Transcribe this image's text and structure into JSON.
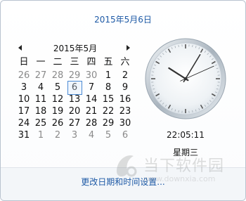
{
  "header": {
    "date_link": "2015年5月6日"
  },
  "calendar": {
    "month_title": "2015年5月",
    "weekdays": [
      "日",
      "一",
      "二",
      "三",
      "四",
      "五",
      "六"
    ],
    "selected_day": "6",
    "weeks": [
      [
        {
          "d": "26",
          "o": true
        },
        {
          "d": "27",
          "o": true
        },
        {
          "d": "28",
          "o": true
        },
        {
          "d": "29",
          "o": true
        },
        {
          "d": "30",
          "o": true
        },
        {
          "d": "1",
          "o": false
        },
        {
          "d": "2",
          "o": false
        }
      ],
      [
        {
          "d": "3",
          "o": false
        },
        {
          "d": "4",
          "o": false
        },
        {
          "d": "5",
          "o": false
        },
        {
          "d": "6",
          "o": false,
          "t": true
        },
        {
          "d": "7",
          "o": false
        },
        {
          "d": "8",
          "o": false
        },
        {
          "d": "9",
          "o": false
        }
      ],
      [
        {
          "d": "10",
          "o": false
        },
        {
          "d": "11",
          "o": false
        },
        {
          "d": "12",
          "o": false
        },
        {
          "d": "13",
          "o": false
        },
        {
          "d": "14",
          "o": false
        },
        {
          "d": "15",
          "o": false
        },
        {
          "d": "16",
          "o": false
        }
      ],
      [
        {
          "d": "17",
          "o": false
        },
        {
          "d": "18",
          "o": false
        },
        {
          "d": "19",
          "o": false
        },
        {
          "d": "20",
          "o": false
        },
        {
          "d": "21",
          "o": false
        },
        {
          "d": "22",
          "o": false
        },
        {
          "d": "23",
          "o": false
        }
      ],
      [
        {
          "d": "24",
          "o": false
        },
        {
          "d": "25",
          "o": false
        },
        {
          "d": "26",
          "o": false
        },
        {
          "d": "27",
          "o": false
        },
        {
          "d": "28",
          "o": false
        },
        {
          "d": "29",
          "o": false
        },
        {
          "d": "30",
          "o": false
        }
      ],
      [
        {
          "d": "31",
          "o": false
        },
        {
          "d": "1",
          "o": true
        },
        {
          "d": "2",
          "o": true
        },
        {
          "d": "3",
          "o": true
        },
        {
          "d": "4",
          "o": true
        },
        {
          "d": "5",
          "o": true
        },
        {
          "d": "6",
          "o": true
        }
      ]
    ]
  },
  "clock": {
    "time": "22:05:11",
    "weekday": "星期三",
    "hours": 22,
    "minutes": 5,
    "seconds": 11
  },
  "footer": {
    "settings_link": "更改日期和时间设置..."
  },
  "watermark": {
    "text": "当下软件园",
    "subtext": "www.downxia.com"
  },
  "colors": {
    "link": "#1e5aa6",
    "today_border": "#4a8ad4",
    "other_month": "#8a8a8a"
  },
  "icons": {
    "prev": "chevron-left-icon",
    "next": "chevron-right-icon"
  }
}
